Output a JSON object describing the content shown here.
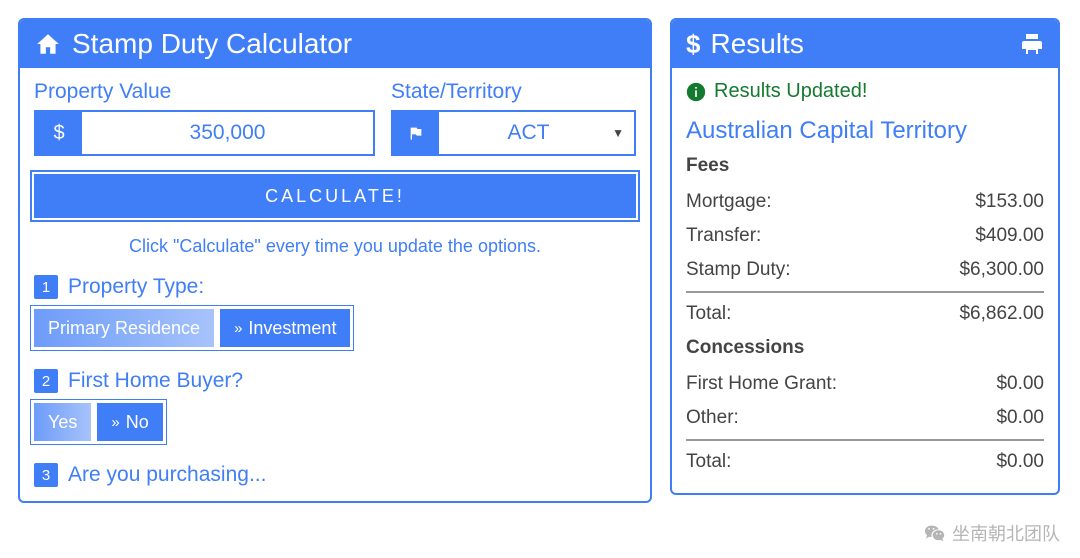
{
  "calculator": {
    "title": "Stamp Duty Calculator",
    "propertyValueLabel": "Property Value",
    "propertyValue": "350,000",
    "stateLabel": "State/Territory",
    "stateSelected": "ACT",
    "calculateLabel": "CALCULATE!",
    "helper": "Click \"Calculate\" every time you update the options.",
    "questions": [
      {
        "num": "1",
        "text": "Property Type:",
        "options": [
          {
            "label": "Primary Residence",
            "state": "active"
          },
          {
            "label": "Investment",
            "state": "inactive"
          }
        ]
      },
      {
        "num": "2",
        "text": "First Home Buyer?",
        "options": [
          {
            "label": "Yes",
            "state": "active"
          },
          {
            "label": "No",
            "state": "inactive"
          }
        ]
      },
      {
        "num": "3",
        "text": "Are you purchasing...",
        "options": []
      }
    ]
  },
  "results": {
    "title": "Results",
    "status": "Results Updated!",
    "region": "Australian Capital Territory",
    "feesHeading": "Fees",
    "fees": [
      {
        "label": "Mortgage:",
        "value": "$153.00"
      },
      {
        "label": "Transfer:",
        "value": "$409.00"
      },
      {
        "label": "Stamp Duty:",
        "value": "$6,300.00"
      }
    ],
    "feesTotal": {
      "label": "Total:",
      "value": "$6,862.00"
    },
    "concessionsHeading": "Concessions",
    "concessions": [
      {
        "label": "First Home Grant:",
        "value": "$0.00"
      },
      {
        "label": "Other:",
        "value": "$0.00"
      }
    ],
    "concessionsTotal": {
      "label": "Total:",
      "value": "$0.00"
    }
  },
  "watermark": "坐南朝北团队"
}
